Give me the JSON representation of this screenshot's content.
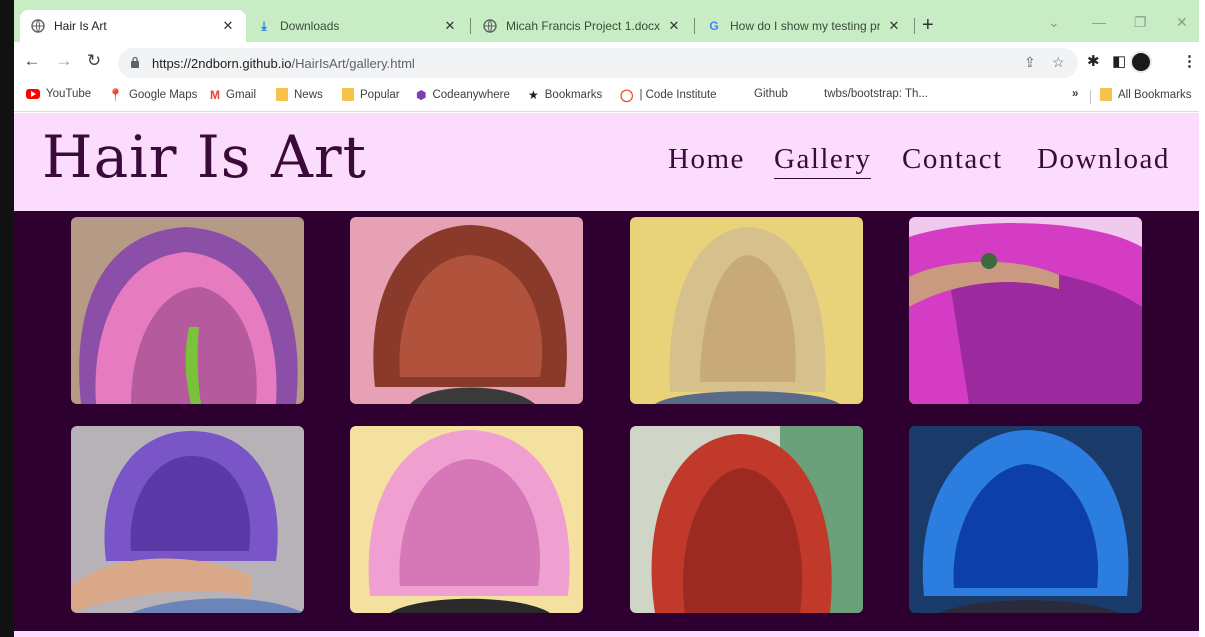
{
  "tabs": [
    {
      "title": "Hair Is Art",
      "icon": "globe-icon",
      "active": true
    },
    {
      "title": "Downloads",
      "icon": "download-icon",
      "active": false
    },
    {
      "title": "Micah Francis Project 1.docx",
      "icon": "globe-icon",
      "active": false
    },
    {
      "title": "How do I show my testing proce",
      "icon": "google-icon",
      "active": false
    }
  ],
  "toolbar": {
    "url_host": "https://2ndborn.github.io",
    "url_path": "/HairIsArt/gallery.html"
  },
  "bookmarks": [
    {
      "label": "YouTube",
      "icon": "youtube-icon"
    },
    {
      "label": "Google Maps",
      "icon": "maps-pin-icon"
    },
    {
      "label": "Gmail",
      "icon": "gmail-icon"
    },
    {
      "label": "News",
      "icon": "folder-icon"
    },
    {
      "label": "Popular",
      "icon": "folder-icon"
    },
    {
      "label": "Codeanywhere",
      "icon": "cube-icon"
    },
    {
      "label": "Bookmarks",
      "icon": "star-icon"
    },
    {
      "label": "| Code Institute",
      "icon": "ring-icon"
    },
    {
      "label": "Github",
      "icon": ""
    },
    {
      "label": "twbs/bootstrap: Th...",
      "icon": ""
    }
  ],
  "bookmarks_overflow": "»",
  "all_bookmarks": "All Bookmarks",
  "site": {
    "logo": "Hair Is Art",
    "nav": [
      {
        "label": "Home",
        "active": false
      },
      {
        "label": "Gallery",
        "active": true
      },
      {
        "label": "Contact",
        "active": false
      },
      {
        "label": "Download",
        "active": false
      }
    ]
  },
  "gallery": {
    "photos": [
      {
        "subject": "pink-purple bob",
        "colors": [
          "#8c4fa8",
          "#e77bbf",
          "#b65a9e"
        ]
      },
      {
        "subject": "auburn curly bob",
        "colors": [
          "#e6a2b4",
          "#8a3a2a",
          "#b0523c"
        ]
      },
      {
        "subject": "blonde straight bob",
        "colors": [
          "#e8d27a",
          "#d6c08c",
          "#c7a97a"
        ]
      },
      {
        "subject": "magenta long hair",
        "colors": [
          "#f1c8ee",
          "#d43cc4",
          "#9c2a9e"
        ]
      },
      {
        "subject": "violet bob",
        "colors": [
          "#b6b2b8",
          "#7a55c8",
          "#5b3aa8"
        ]
      },
      {
        "subject": "bubblegum pink waves",
        "colors": [
          "#f4e1a0",
          "#f0a0d0",
          "#d677b8"
        ]
      },
      {
        "subject": "red wavy hair",
        "colors": [
          "#cfd6c8",
          "#c0392b",
          "#9c2a22"
        ]
      },
      {
        "subject": "electric blue bob",
        "colors": [
          "#1a3b6a",
          "#2b7de0",
          "#0d3fa8"
        ]
      }
    ]
  },
  "colors": {
    "header_bg": "#fcdcfc",
    "gallery_bg": "#2e0030",
    "brand_text": "#3a0a3a",
    "tabstrip_bg": "#c8ecc4"
  }
}
